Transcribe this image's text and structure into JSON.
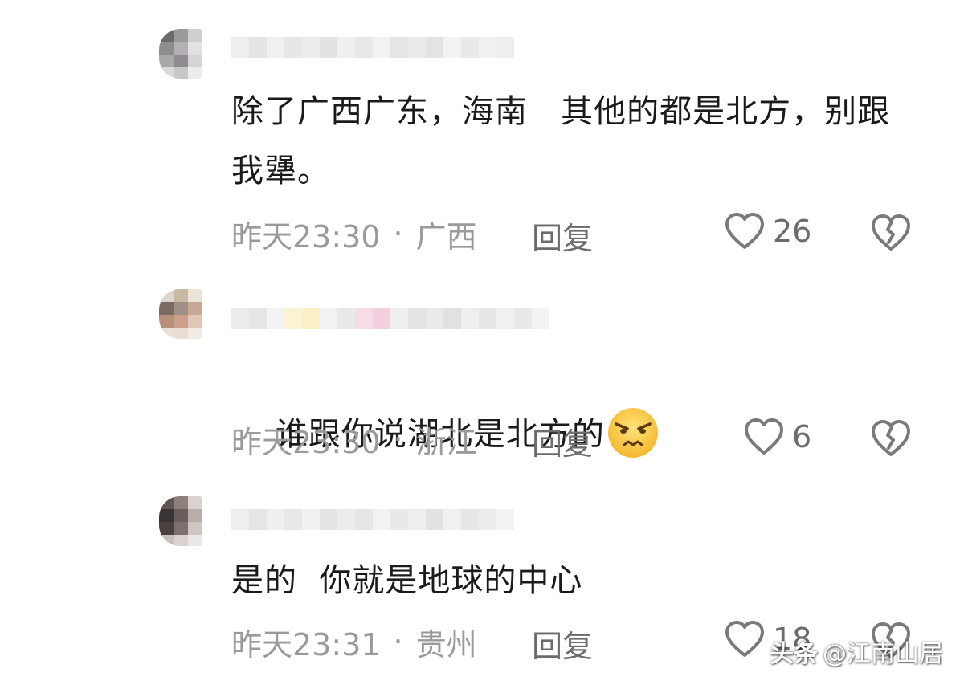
{
  "comments": [
    {
      "text": "除了广西广东，海南   其他的都是北方，别跟我犟。",
      "time": "昨天23:30",
      "location": "广西",
      "reply_label": "回复",
      "like_count": "26"
    },
    {
      "text": "谁跟你说湖北是北方的",
      "time": "昨天23:30",
      "location": "浙江",
      "reply_label": "回复",
      "like_count": "6"
    },
    {
      "text": "是的  你就是地球的中心",
      "time": "昨天23:31",
      "location": "贵州",
      "reply_label": "回复",
      "like_count": "18"
    }
  ],
  "meta_separator": "·",
  "icons": {
    "like": "heart-outline-icon",
    "dislike": "broken-heart-icon",
    "emoji": "frowning-face-emoji"
  },
  "colors": {
    "text": "#1a1a1a",
    "meta": "#9a9a9a",
    "action": "#6c6c6c",
    "icon": "#7a7a7a"
  },
  "watermark": {
    "platform": "头条",
    "account": "@江南山居"
  }
}
